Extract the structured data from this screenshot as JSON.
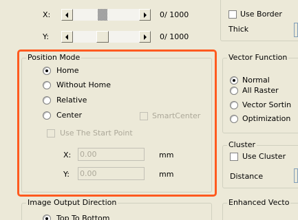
{
  "scroll_x": {
    "label": "X:",
    "readout": "0/ 1000",
    "value": 0,
    "max": 1000
  },
  "scroll_y": {
    "label": "Y:",
    "readout": "0/ 1000",
    "value": 0,
    "max": 1000
  },
  "border": {
    "use_border_label": "Use Border",
    "thick_label": "Thick"
  },
  "position_mode": {
    "title": "Position Mode",
    "options": [
      "Home",
      "Without Home",
      "Relative",
      "Center"
    ],
    "selected": "Home",
    "smart_center_label": "SmartCenter",
    "use_start_point_label": "Use The Start Point",
    "x_label": "X:",
    "x_value": "0.00",
    "y_label": "Y:",
    "y_value": "0.00",
    "unit": "mm"
  },
  "vector_function": {
    "title": "Vector Function",
    "options": [
      "Normal",
      "All Raster",
      "Vector Sortin",
      "Optimization"
    ],
    "selected": "Normal"
  },
  "cluster": {
    "title": "Cluster",
    "use_cluster_label": "Use Cluster",
    "distance_label": "Distance"
  },
  "image_output": {
    "title": "Image Output Direction",
    "option": "Top To Bottom"
  },
  "enhanced": {
    "title": "Enhanced Vecto"
  },
  "colors": {
    "dialog_bg": "#ece9d8",
    "highlight": "#ff5a1f",
    "disabled_text": "#aca899"
  }
}
